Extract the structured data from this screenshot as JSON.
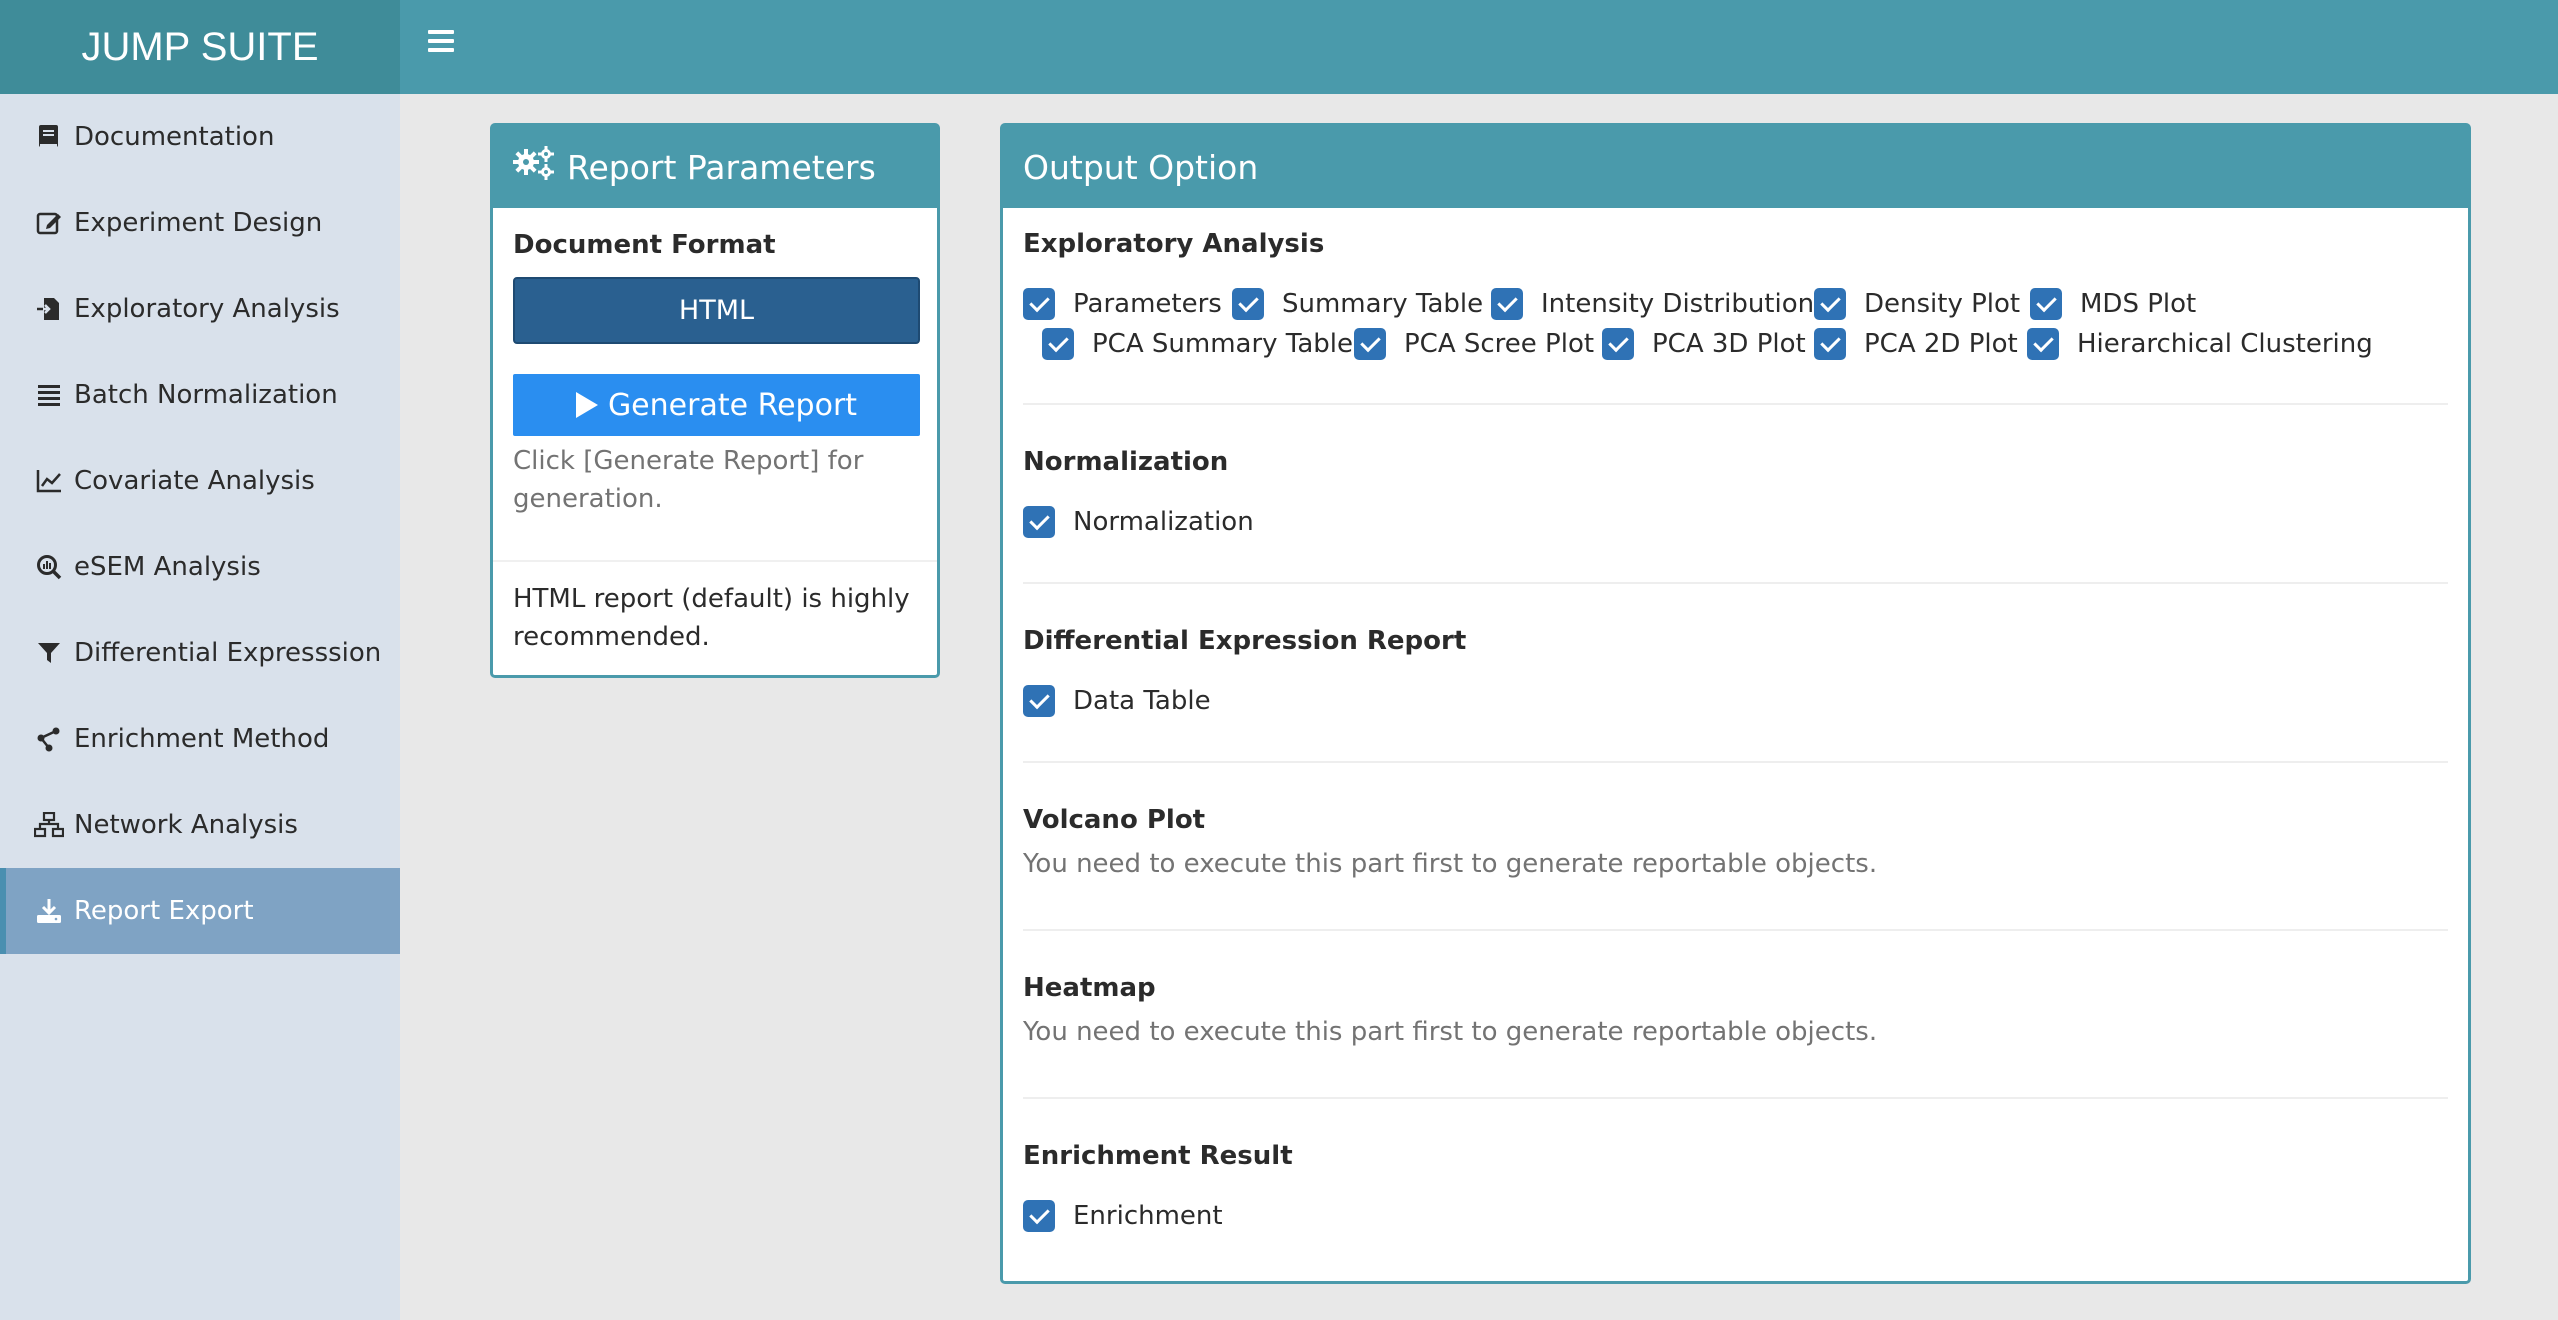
{
  "app": {
    "title": "JUMP SUITE"
  },
  "sidebar": {
    "items": [
      {
        "label": "Documentation",
        "icon": "book-icon"
      },
      {
        "label": "Experiment Design",
        "icon": "edit-icon"
      },
      {
        "label": "Exploratory Analysis",
        "icon": "file-import-icon"
      },
      {
        "label": "Batch Normalization",
        "icon": "list-icon"
      },
      {
        "label": "Covariate Analysis",
        "icon": "line-chart-icon"
      },
      {
        "label": "eSEM Analysis",
        "icon": "search-chart-icon"
      },
      {
        "label": "Differential Expresssion",
        "icon": "filter-icon"
      },
      {
        "label": "Enrichment Method",
        "icon": "share-icon"
      },
      {
        "label": "Network Analysis",
        "icon": "sitemap-icon"
      },
      {
        "label": "Report Export",
        "icon": "download-icon",
        "active": true
      }
    ]
  },
  "report_params": {
    "title": "Report Parameters",
    "doc_format_label": "Document Format",
    "doc_format_value": "HTML",
    "generate_label": "Generate Report",
    "help_text": "Click [Generate Report] for generation.",
    "note": "HTML report (default) is highly recommended."
  },
  "output": {
    "title": "Output Option",
    "exploratory": {
      "title": "Exploratory Analysis",
      "options": [
        "Parameters",
        "Summary Table",
        "Intensity Distribution",
        "Density Plot",
        "MDS Plot",
        "PCA Summary Table",
        "PCA Scree Plot",
        "PCA 3D Plot",
        "PCA 2D Plot",
        "Hierarchical Clustering"
      ]
    },
    "normalization": {
      "title": "Normalization",
      "options": [
        "Normalization"
      ]
    },
    "differential": {
      "title": "Differential Expression Report",
      "options": [
        "Data Table"
      ]
    },
    "volcano": {
      "title": "Volcano Plot",
      "message": "You need to execute this part first to generate reportable objects."
    },
    "heatmap": {
      "title": "Heatmap",
      "message": "You need to execute this part first to generate reportable objects."
    },
    "enrichment": {
      "title": "Enrichment Result",
      "options": [
        "Enrichment"
      ]
    }
  },
  "colors": {
    "header": "#4a9aab",
    "logo_bg": "#3f8c99",
    "checkbox": "#2f72b5",
    "generate_btn": "#2a8ef0",
    "select_bg": "#2a6090"
  }
}
